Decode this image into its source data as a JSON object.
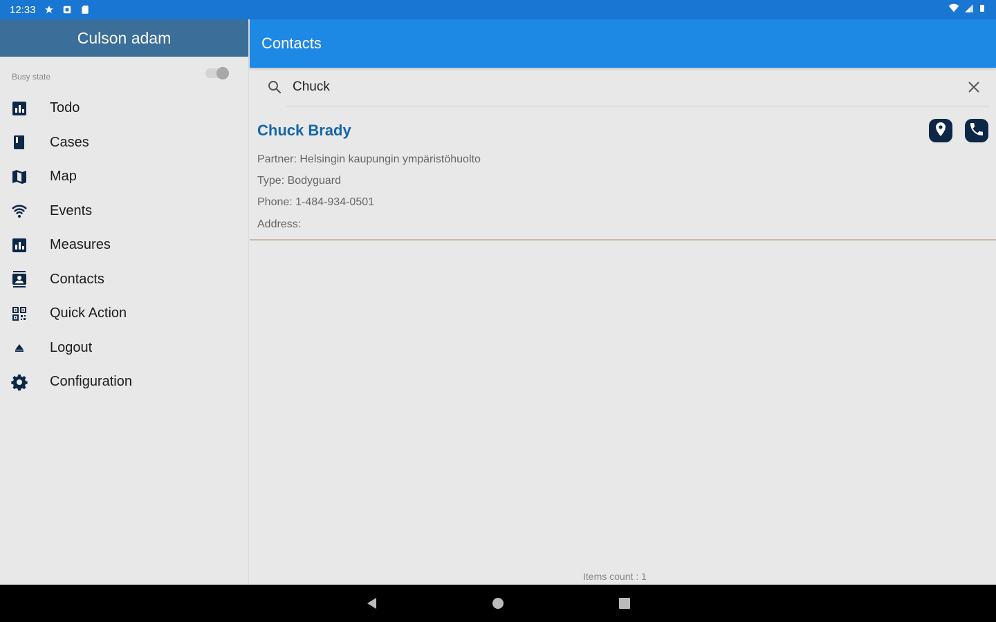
{
  "status_bar": {
    "time": "12:33"
  },
  "drawer": {
    "user_name": "Culson adam",
    "busy_state_label": "Busy state",
    "menu": [
      {
        "label": "Todo",
        "icon": "todo-icon"
      },
      {
        "label": "Cases",
        "icon": "book-icon"
      },
      {
        "label": "Map",
        "icon": "map-icon"
      },
      {
        "label": "Events",
        "icon": "wifi-icon"
      },
      {
        "label": "Measures",
        "icon": "measures-icon"
      },
      {
        "label": "Contacts",
        "icon": "contacts-icon"
      },
      {
        "label": "Quick Action",
        "icon": "qr-code-icon"
      },
      {
        "label": "Logout",
        "icon": "eject-icon"
      },
      {
        "label": "Configuration",
        "icon": "gear-icon"
      }
    ]
  },
  "appbar": {
    "title": "Contacts"
  },
  "search": {
    "value": "Chuck"
  },
  "contact": {
    "name": "Chuck Brady",
    "partner": "Partner: Helsingin kaupungin ympäristöhuolto",
    "type": "Type: Bodyguard",
    "phone": "Phone: 1-484-934-0501",
    "address": "Address:"
  },
  "footer": {
    "items_count": "Items count : 1"
  },
  "colors": {
    "status_bar": "#1976d2",
    "drawer_header": "#3b6e99",
    "appbar": "#1e88e5",
    "contact_name": "#1565a8",
    "icon_dark": "#0d2747"
  }
}
